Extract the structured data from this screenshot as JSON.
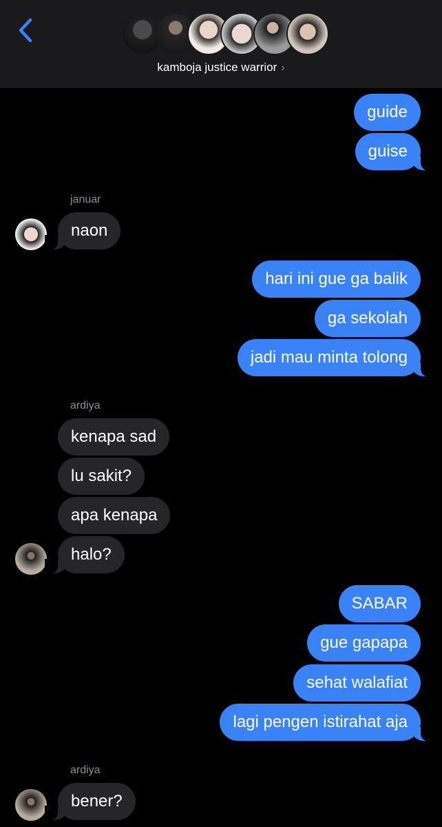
{
  "header": {
    "group_name": "kamboja justice warrior",
    "back_icon": "chevron-left-icon",
    "accent": "#3a82f7"
  },
  "colors": {
    "outgoing_bubble": "#3a82f7",
    "incoming_bubble": "#262628",
    "sender_label": "#8e8e93"
  },
  "messages": [
    {
      "dir": "out",
      "text": "guide"
    },
    {
      "dir": "out",
      "text": "guise"
    },
    {
      "dir": "in",
      "sender": "januar",
      "text": "naon"
    },
    {
      "dir": "out",
      "text": "hari ini gue ga balik"
    },
    {
      "dir": "out",
      "text": "ga sekolah"
    },
    {
      "dir": "out",
      "text": "jadi mau minta tolong"
    },
    {
      "dir": "in",
      "sender": "ardiya",
      "text": "kenapa sad"
    },
    {
      "dir": "in",
      "sender": "ardiya",
      "text": "lu sakit?"
    },
    {
      "dir": "in",
      "sender": "ardiya",
      "text": "apa kenapa"
    },
    {
      "dir": "in",
      "sender": "ardiya",
      "text": "halo?"
    },
    {
      "dir": "out",
      "text": "SABAR"
    },
    {
      "dir": "out",
      "text": "gue gapapa"
    },
    {
      "dir": "out",
      "text": "sehat walafiat"
    },
    {
      "dir": "out",
      "text": "lagi pengen istirahat aja"
    },
    {
      "dir": "in",
      "sender": "ardiya",
      "text": "bener?"
    }
  ],
  "sender_labels": [
    "januar",
    "ardiya",
    "ardiya"
  ]
}
